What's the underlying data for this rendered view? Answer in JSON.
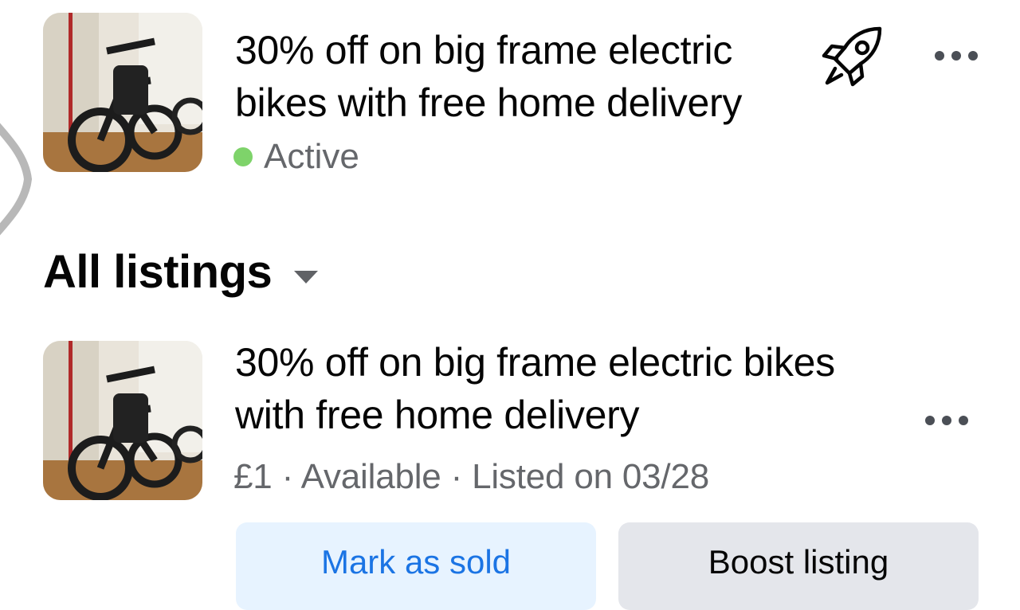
{
  "featured_listing": {
    "title": "30% off on big frame electric bikes with free home delivery",
    "status": "Active",
    "status_color": "#7ed36a",
    "boost_icon": "rocket-icon",
    "more_icon": "more-options-icon"
  },
  "section": {
    "title": "All listings",
    "caret_icon": "caret-down-icon"
  },
  "listing": {
    "title": "30% off on big frame electric bikes with free home delivery",
    "meta": "£1 · Available · Listed on 03/28",
    "more_icon": "more-options-icon",
    "mark_sold_label": "Mark as sold",
    "boost_label": "Boost listing"
  },
  "colors": {
    "primary_blue": "#1b74e4",
    "light_blue_bg": "#e7f3ff",
    "gray_button_bg": "#e4e6eb",
    "secondary_text": "#65676b"
  }
}
